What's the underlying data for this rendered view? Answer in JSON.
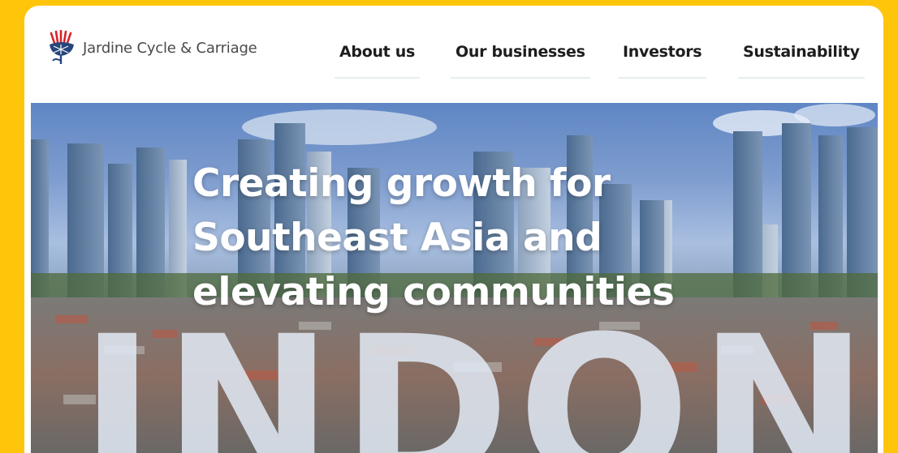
{
  "brand": {
    "name": "Jardine Cycle & Carriage",
    "logo_icon": "thistle-logo-icon",
    "colors": {
      "frame": "#FFC50B",
      "logo_red": "#d8232a",
      "logo_blue": "#27457d"
    }
  },
  "nav": {
    "items": [
      {
        "label": "About us"
      },
      {
        "label": "Our businesses"
      },
      {
        "label": "Investors"
      },
      {
        "label": "Sustainability"
      }
    ]
  },
  "hero": {
    "headline_lines": [
      "Creating growth for",
      "Southeast Asia and",
      "elevating communities"
    ],
    "overlay_word": "INDONE"
  }
}
